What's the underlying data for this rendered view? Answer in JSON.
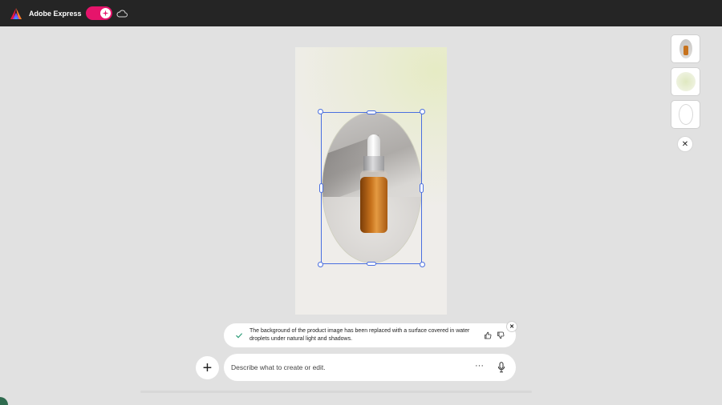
{
  "app": {
    "title": "Adobe Express",
    "brand_color": "#e6146b",
    "logo_icon": "adobe-express-logo",
    "cloud_icon": "cloud-icon"
  },
  "canvas": {
    "background": "#efedea",
    "glow_color": "#e6ebc4"
  },
  "variations": {
    "items": [
      "product-with-background-thumbnail",
      "green-glow-thumbnail",
      "oval-frame-thumbnail"
    ],
    "close_label": "✕"
  },
  "assistant_message": {
    "text": "The background of the product image has been replaced with a surface covered in water droplets under natural light and shadows.",
    "status_icon": "check-icon",
    "close_label": "✕"
  },
  "prompt": {
    "add_label": "+",
    "placeholder": "Describe what to create or edit.",
    "more_label": "···"
  },
  "selection_color": "#4a6fe0"
}
